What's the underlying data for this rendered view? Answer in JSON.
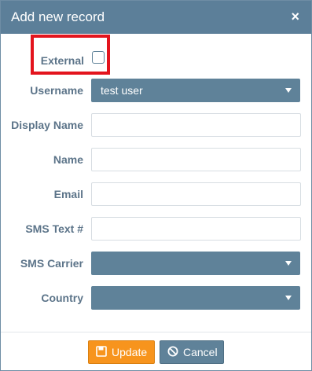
{
  "dialog": {
    "title": "Add new record",
    "close_label": "×"
  },
  "form": {
    "external": {
      "label": "External",
      "checked": false
    },
    "username": {
      "label": "Username",
      "value": "test user"
    },
    "display_name": {
      "label": "Display Name",
      "value": ""
    },
    "name": {
      "label": "Name",
      "value": ""
    },
    "email": {
      "label": "Email",
      "value": ""
    },
    "sms_text": {
      "label": "SMS Text #",
      "value": ""
    },
    "sms_carrier": {
      "label": "SMS Carrier",
      "value": ""
    },
    "country": {
      "label": "Country",
      "value": ""
    }
  },
  "footer": {
    "update_label": "Update",
    "cancel_label": "Cancel"
  },
  "colors": {
    "header": "#5c7f99",
    "label": "#5c7489",
    "select": "#5f8299",
    "update": "#f7941d",
    "highlight": "#e3141d"
  },
  "icons": {
    "update": "save-icon",
    "cancel": "cancel-icon",
    "close": "close-icon"
  }
}
